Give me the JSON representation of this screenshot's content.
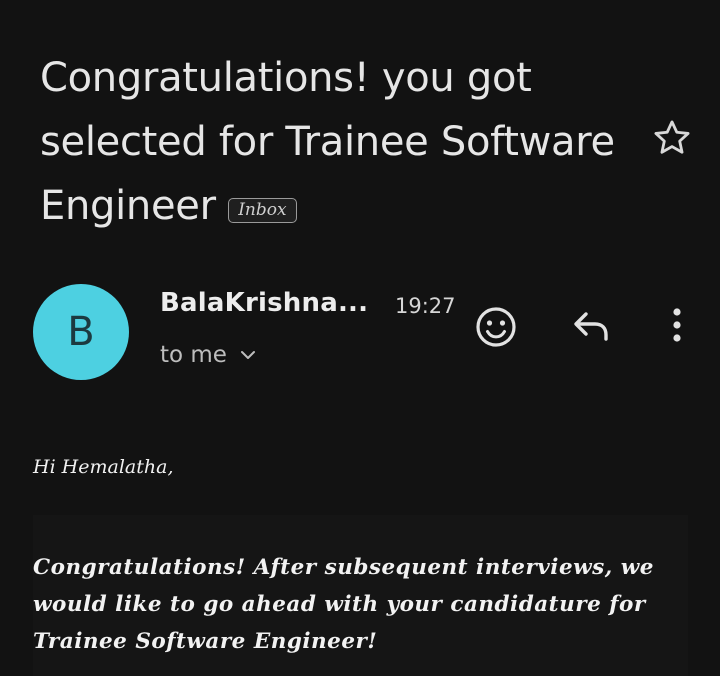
{
  "email": {
    "subject": "Congratulations! you got selected for Trainee Software Engineer",
    "label": "Inbox",
    "sender": {
      "initial": "B",
      "name": "BalaKrishna...",
      "avatar_color": "#4dd0e1"
    },
    "time": "19:27",
    "recipient": "to me",
    "greeting": "Hi Hemalatha,",
    "body": "Congratulations! After subsequent interviews, we would like to go ahead with your candidature for Trainee Software Engineer!"
  },
  "icons": {
    "star": "star-outline-icon",
    "emoji": "emoji-reaction-icon",
    "reply": "reply-icon",
    "more": "more-vert-icon",
    "expand": "chevron-down-icon"
  },
  "colors": {
    "background": "#121212",
    "accent_avatar": "#4dd0e1"
  }
}
